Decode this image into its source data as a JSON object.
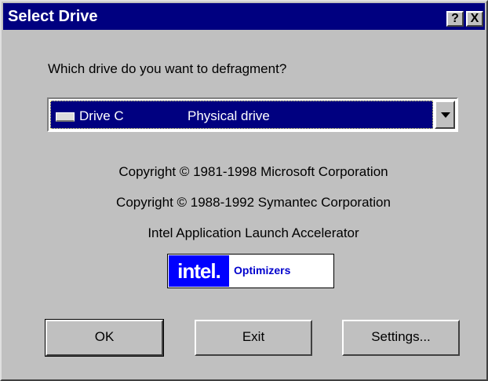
{
  "window": {
    "title": "Select Drive",
    "help_label": "?",
    "close_label": "X"
  },
  "prompt": "Which drive do you want to defragment?",
  "drive_select": {
    "icon": "drive-icon",
    "selected_name": "Drive C",
    "selected_type": "Physical drive"
  },
  "credits": [
    "Copyright © 1981-1998 Microsoft Corporation",
    "Copyright © 1988-1992 Symantec Corporation",
    "Intel Application Launch Accelerator"
  ],
  "intel_logo": {
    "brand": "intel.",
    "product": "Optimizers",
    "brand_bg": "#0000ff",
    "product_color": "#0000cc"
  },
  "buttons": {
    "ok": "OK",
    "exit": "Exit",
    "settings": "Settings..."
  },
  "colors": {
    "titlebar": "#000080",
    "face": "#c0c0c0",
    "selection": "#000080"
  }
}
